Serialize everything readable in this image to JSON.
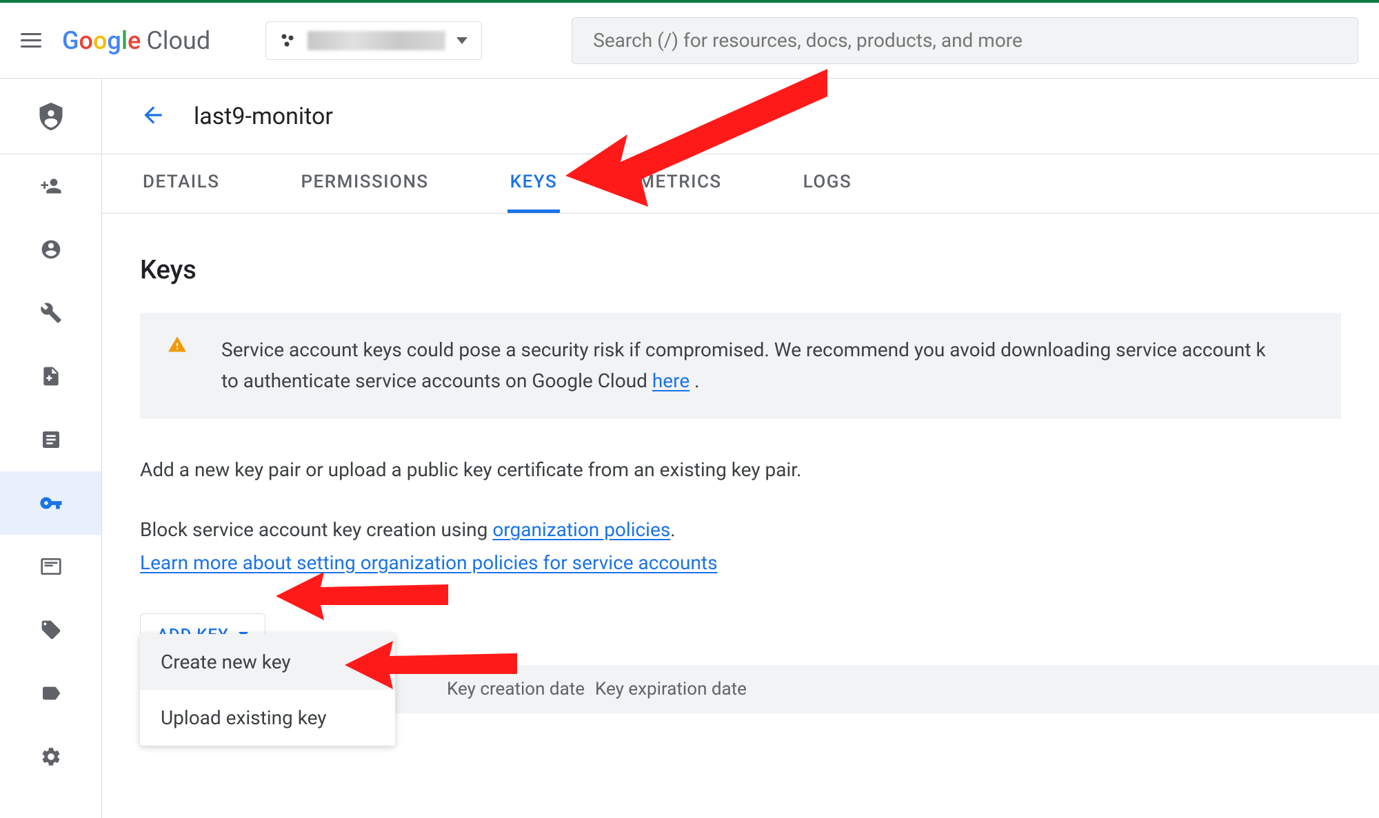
{
  "header": {
    "logo_text": "Cloud",
    "search_placeholder": "Search (/) for resources, docs, products, and more"
  },
  "page": {
    "title": "last9-monitor"
  },
  "tabs": [
    {
      "label": "DETAILS",
      "active": false
    },
    {
      "label": "PERMISSIONS",
      "active": false
    },
    {
      "label": "KEYS",
      "active": true
    },
    {
      "label": "METRICS",
      "active": false
    },
    {
      "label": "LOGS",
      "active": false
    }
  ],
  "keys_section": {
    "title": "Keys",
    "warning_text_1": "Service account keys could pose a security risk if compromised. We recommend you avoid downloading service account k",
    "warning_text_2": "to authenticate service accounts on Google Cloud ",
    "warning_link": "here",
    "warning_text_3": " .",
    "desc_1": "Add a new key pair or upload a public key certificate from an existing key pair.",
    "desc_2a": "Block service account key creation using ",
    "desc_2_link": "organization policies",
    "desc_2b": ".",
    "desc_3_link": "Learn more about setting organization policies for service accounts",
    "add_key_btn": "ADD KEY"
  },
  "dropdown": {
    "item_1": "Create new key",
    "item_2": "Upload existing key"
  },
  "table": {
    "col_1": "Key creation date",
    "col_2": "Key expiration date"
  }
}
